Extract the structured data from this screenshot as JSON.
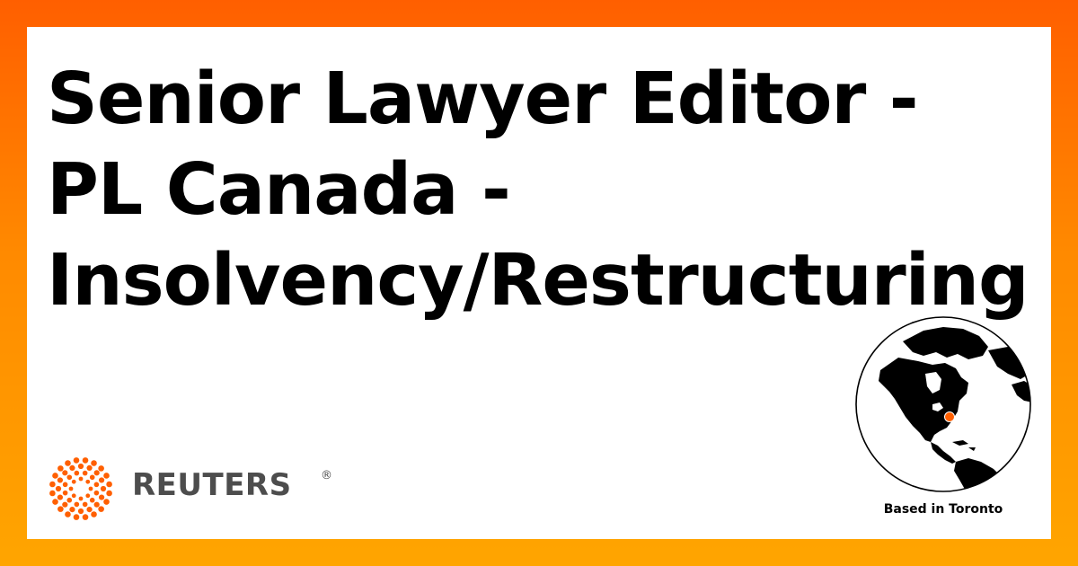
{
  "job": {
    "title": "Senior Lawyer Editor - PL Canada - Insolvency/Restructuring",
    "location_label": "Based in Toronto"
  },
  "brand": {
    "name": "REUTERS",
    "registered_mark": "®",
    "logo_icon": "reuters-dot-ring-icon",
    "accent_color": "#ff5f00",
    "text_color": "#4d4d4d"
  },
  "globe": {
    "icon": "globe-icon",
    "marker_color": "#ff5f00"
  }
}
